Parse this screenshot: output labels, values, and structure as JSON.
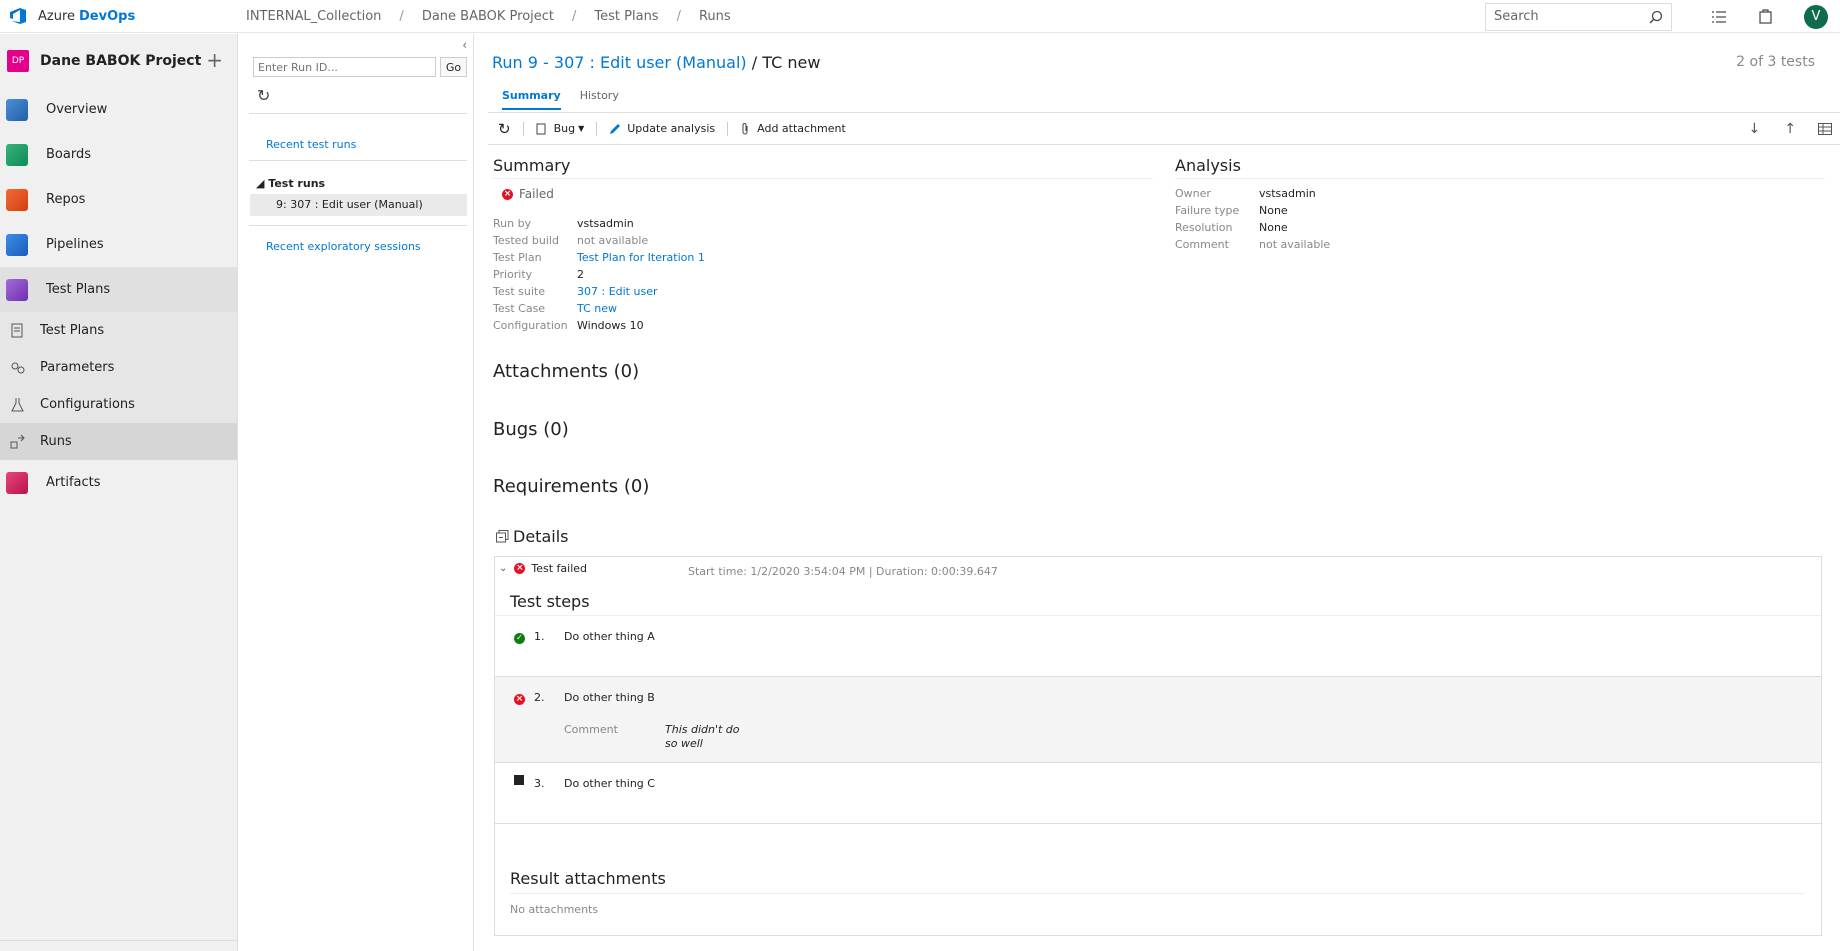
{
  "app": {
    "brand_prefix": "Azure",
    "brand_name": "DevOps"
  },
  "breadcrumb": [
    "INTERNAL_Collection",
    "Dane BABOK Project",
    "Test Plans",
    "Runs"
  ],
  "search": {
    "placeholder": "Search"
  },
  "user": {
    "initial": "V"
  },
  "project": {
    "badge": "DP",
    "name": "Dane BABOK Project"
  },
  "nav": {
    "overview": "Overview",
    "boards": "Boards",
    "repos": "Repos",
    "pipelines": "Pipelines",
    "test_plans": "Test Plans",
    "sub": {
      "test_plans": "Test Plans",
      "parameters": "Parameters",
      "configurations": "Configurations",
      "runs": "Runs"
    },
    "artifacts": "Artifacts"
  },
  "runs_panel": {
    "input_placeholder": "Enter Run ID...",
    "go_label": "Go",
    "recent_runs": "Recent test runs",
    "group_label": "Test runs",
    "selected_run": "9: 307 : Edit user (Manual)",
    "recent_sessions": "Recent exploratory sessions"
  },
  "header": {
    "run_link": "Run 9 - 307 : Edit user (Manual)",
    "separator": " / ",
    "case_name": "TC new",
    "count": "2 of 3 tests"
  },
  "tabs": {
    "summary": "Summary",
    "history": "History"
  },
  "toolbar": {
    "bug": "Bug",
    "update_analysis": "Update analysis",
    "add_attachment": "Add attachment"
  },
  "summary": {
    "title": "Summary",
    "status": "Failed",
    "fields": [
      {
        "k": "Run by",
        "v": "vstsadmin"
      },
      {
        "k": "Tested build",
        "v": "not available"
      },
      {
        "k": "Test Plan",
        "v": "Test Plan for Iteration 1"
      },
      {
        "k": "Priority",
        "v": "2"
      },
      {
        "k": "Test suite",
        "v": "307 : Edit user"
      },
      {
        "k": "Test Case",
        "v": "TC new"
      },
      {
        "k": "Configuration",
        "v": "Windows 10"
      }
    ]
  },
  "analysis": {
    "title": "Analysis",
    "fields": [
      {
        "k": "Owner",
        "v": "vstsadmin"
      },
      {
        "k": "Failure type",
        "v": "None"
      },
      {
        "k": "Resolution",
        "v": "None"
      },
      {
        "k": "Comment",
        "v": "not available"
      }
    ]
  },
  "sections": {
    "attachments": "Attachments (0)",
    "bugs": "Bugs (0)",
    "requirements": "Requirements (0)",
    "details": "Details"
  },
  "details": {
    "result": "Test failed",
    "time": "Start time: 1/2/2020 3:54:04 PM | Duration: 0:00:39.647",
    "steps_title": "Test steps",
    "steps": [
      {
        "num": "1.",
        "text": "Do other thing A"
      },
      {
        "num": "2.",
        "text": "Do other thing B",
        "comment_label": "Comment",
        "comment": "This didn't do so well"
      },
      {
        "num": "3.",
        "text": "Do other thing C"
      }
    ],
    "attachments_title": "Result attachments",
    "attachments_empty": "No attachments"
  }
}
